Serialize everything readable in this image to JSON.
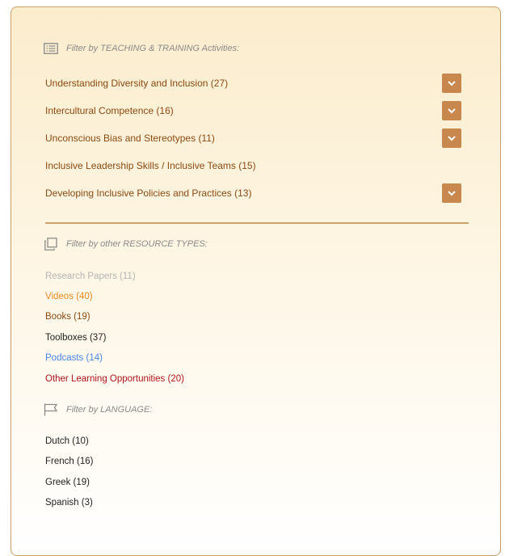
{
  "teaching": {
    "heading": "Filter by TEACHING & TRAINING Activities:",
    "items": [
      {
        "label": "Understanding Diversity and Inclusion (27)",
        "expandable": true
      },
      {
        "label": "Intercultural Competence (16)",
        "expandable": true
      },
      {
        "label": "Unconscious Bias and Stereotypes (11)",
        "expandable": true
      },
      {
        "label": "Inclusive Leadership Skills / Inclusive Teams (15)",
        "expandable": false
      },
      {
        "label": "Developing Inclusive Policies and Practices (13)",
        "expandable": true
      }
    ]
  },
  "resources": {
    "heading": "Filter by other RESOURCE TYPES:",
    "items": [
      {
        "label": "Research Papers (11)",
        "color": "#b5b5b5"
      },
      {
        "label": "Videos (40)",
        "color": "#f08a1e"
      },
      {
        "label": "Books (19)",
        "color": "#8b4a12"
      },
      {
        "label": "Toolboxes (37)",
        "color": "#222222"
      },
      {
        "label": "Podcasts (14)",
        "color": "#4a86e8"
      },
      {
        "label": "Other Learning Opportunities (20)",
        "color": "#b0131c"
      }
    ]
  },
  "language": {
    "heading": "Filter by LANGUAGE:",
    "items": [
      {
        "label": "Dutch (10)"
      },
      {
        "label": "French (16)"
      },
      {
        "label": "Greek (19)"
      },
      {
        "label": "Spanish (3)"
      }
    ]
  },
  "colors": {
    "accent": "#c8874c",
    "teaching_text": "#8b4a12",
    "language_text": "#222222"
  },
  "icons": {
    "teaching": "list-icon",
    "resources": "copy-icon",
    "language": "flag-icon",
    "toggle": "chevron-down-icon"
  }
}
